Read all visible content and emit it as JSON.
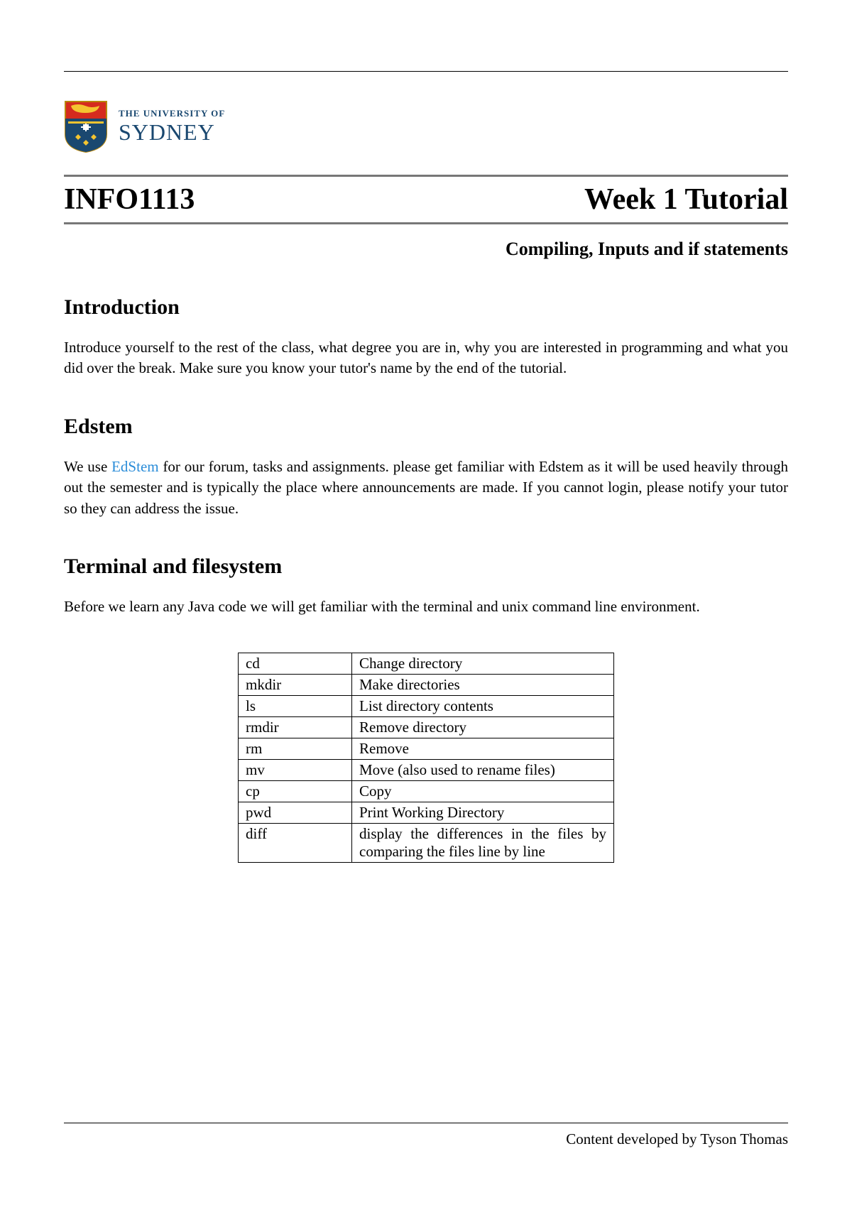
{
  "logo": {
    "small_text": "THE UNIVERSITY OF",
    "large_text": "SYDNEY"
  },
  "header": {
    "course_code": "INFO1113",
    "week_title": "Week 1 Tutorial",
    "subtitle": "Compiling, Inputs and if statements"
  },
  "sections": {
    "introduction": {
      "heading": "Introduction",
      "body": "Introduce yourself to the rest of the class, what degree you are in, why you are interested in programming and what you did over the break. Make sure you know your tutor's name by the end of the tutorial."
    },
    "edstem": {
      "heading": "Edstem",
      "prefix": "We use ",
      "link_text": "EdStem",
      "suffix": " for our forum, tasks and assignments. please get familiar with Edstem as it will be used heavily through out the semester and is typically the place where announcements are made. If you cannot login, please notify your tutor so they can address the issue."
    },
    "terminal": {
      "heading": "Terminal and filesystem",
      "body": "Before we learn any Java code we will get familiar with the terminal and unix command line environment."
    }
  },
  "commands": [
    {
      "cmd": "cd",
      "desc": "Change directory"
    },
    {
      "cmd": "mkdir",
      "desc": "Make directories"
    },
    {
      "cmd": "ls",
      "desc": "List directory contents"
    },
    {
      "cmd": "rmdir",
      "desc": "Remove directory"
    },
    {
      "cmd": "rm",
      "desc": "Remove"
    },
    {
      "cmd": "mv",
      "desc": "Move (also used to rename files)"
    },
    {
      "cmd": "cp",
      "desc": "Copy"
    },
    {
      "cmd": "pwd",
      "desc": "Print Working Directory"
    },
    {
      "cmd": "diff",
      "desc": "display the differences in the files by comparing the files line by line"
    }
  ],
  "footer": {
    "text": "Content developed by Tyson Thomas"
  }
}
